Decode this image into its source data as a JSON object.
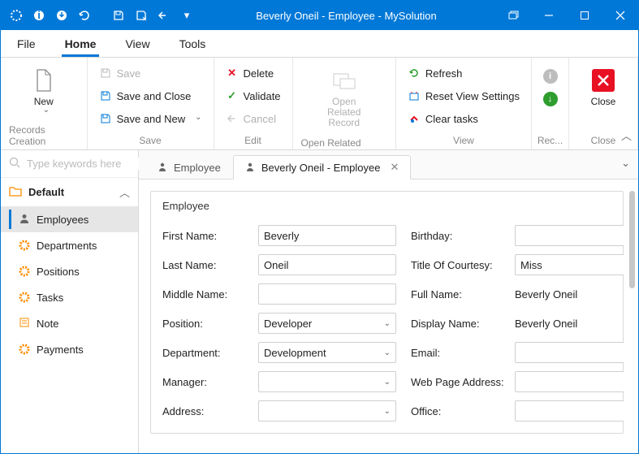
{
  "title": "Beverly Oneil - Employee - MySolution",
  "menubar": [
    "File",
    "Home",
    "View",
    "Tools"
  ],
  "menubar_active": 1,
  "ribbon": {
    "records": {
      "new": "New",
      "caption": "Records Creation"
    },
    "save": {
      "save": "Save",
      "save_close": "Save and Close",
      "save_new": "Save and New",
      "caption": "Save"
    },
    "edit": {
      "delete": "Delete",
      "validate": "Validate",
      "cancel": "Cancel",
      "caption": "Edit"
    },
    "open": {
      "label": "Open Related Record",
      "caption": "Open Related Record"
    },
    "view": {
      "refresh": "Refresh",
      "reset": "Reset View Settings",
      "clear": "Clear tasks",
      "caption": "View"
    },
    "rec": {
      "caption": "Rec..."
    },
    "close": {
      "label": "Close",
      "caption": "Close"
    }
  },
  "sidebar": {
    "search_placeholder": "Type keywords here",
    "folder": "Default",
    "items": [
      {
        "label": "Employees",
        "icon": "person",
        "active": true
      },
      {
        "label": "Departments",
        "icon": "gear"
      },
      {
        "label": "Positions",
        "icon": "gear"
      },
      {
        "label": "Tasks",
        "icon": "gear"
      },
      {
        "label": "Note",
        "icon": "note"
      },
      {
        "label": "Payments",
        "icon": "gear"
      }
    ]
  },
  "tabs": [
    {
      "label": "Employee",
      "closable": false,
      "active": false
    },
    {
      "label": "Beverly Oneil - Employee",
      "closable": true,
      "active": true
    }
  ],
  "form": {
    "title": "Employee",
    "first_name_label": "First Name:",
    "first_name": "Beverly",
    "last_name_label": "Last Name:",
    "last_name": "Oneil",
    "middle_name_label": "Middle Name:",
    "middle_name": "",
    "position_label": "Position:",
    "position": "Developer",
    "department_label": "Department:",
    "department": "Development",
    "manager_label": "Manager:",
    "manager": "",
    "address_label": "Address:",
    "address": "",
    "birthday_label": "Birthday:",
    "birthday": "",
    "courtesy_label": "Title Of Courtesy:",
    "courtesy": "Miss",
    "full_name_label": "Full Name:",
    "full_name": "Beverly Oneil",
    "display_name_label": "Display Name:",
    "display_name": "Beverly Oneil",
    "email_label": "Email:",
    "email": "",
    "webpage_label": "Web Page Address:",
    "webpage": "",
    "office_label": "Office:",
    "office": ""
  },
  "colors": {
    "accent": "#0078d7",
    "danger": "#e81123",
    "orange": "#ff8c00"
  }
}
